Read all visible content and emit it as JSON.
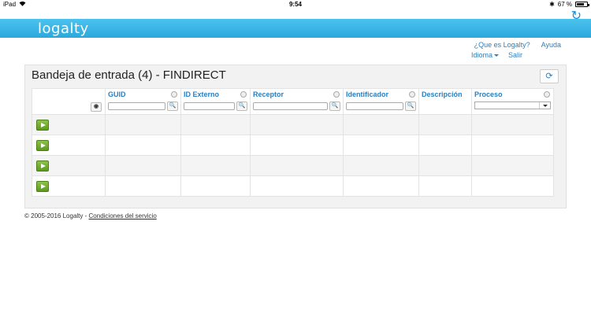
{
  "status_bar": {
    "device": "iPad",
    "time": "9:54",
    "battery": "67 %",
    "battery_level": 0.67
  },
  "header": {
    "logo": "logalty"
  },
  "nav": {
    "about": "¿Que es Logalty?",
    "help": "Ayuda",
    "language": "Idioma",
    "logout": "Salir"
  },
  "panel": {
    "title": "Bandeja de entrada (4) - FINDIRECT",
    "columns": [
      {
        "label": "GUID"
      },
      {
        "label": "ID Externo"
      },
      {
        "label": "Receptor"
      },
      {
        "label": "Identificador"
      },
      {
        "label": "Descripción"
      },
      {
        "label": "Proceso"
      }
    ],
    "rows": 4
  },
  "footer": {
    "copyright": "© 2005-2016 Logalty - ",
    "terms": "Condiciones del servicio"
  }
}
